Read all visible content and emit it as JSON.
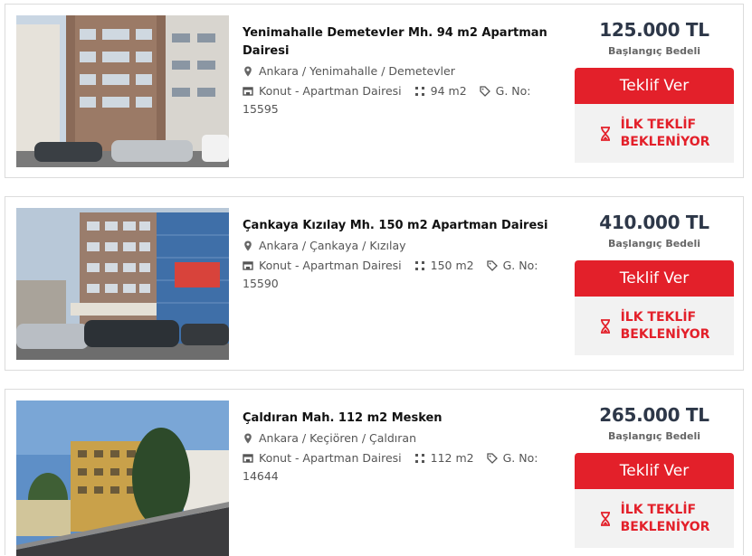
{
  "colors": {
    "accent_red": "#e3202a",
    "price_text": "#2d3748",
    "muted_text": "#555555",
    "panel_bg": "#f2f2f2"
  },
  "icons": {
    "location": "map-pin-icon",
    "type": "building-icon",
    "area": "area-icon",
    "id": "tag-icon",
    "waiting": "hourglass-icon"
  },
  "listings": [
    {
      "title": "Yenimahalle Demetevler Mh. 94 m2 Apartman Dairesi",
      "location": "Ankara / Yenimahalle / Demetevler",
      "type": "Konut - Apartman Dairesi",
      "area": "94 m2",
      "listing_no": "G. No: 15595",
      "price": "125.000 TL",
      "price_caption": "Başlangıç Bedeli",
      "offer_label": "Teklif Ver",
      "status_line1": "İLK TEKLİF",
      "status_line2": "BEKLENİYOR"
    },
    {
      "title": "Çankaya Kızılay Mh. 150 m2 Apartman Dairesi",
      "location": "Ankara / Çankaya / Kızılay",
      "type": "Konut - Apartman Dairesi",
      "area": "150 m2",
      "listing_no": "G. No: 15590",
      "price": "410.000 TL",
      "price_caption": "Başlangıç Bedeli",
      "offer_label": "Teklif Ver",
      "status_line1": "İLK TEKLİF",
      "status_line2": "BEKLENİYOR"
    },
    {
      "title": "Çaldıran Mah. 112 m2 Mesken",
      "location": "Ankara / Keçiören / Çaldıran",
      "type": "Konut - Apartman Dairesi",
      "area": "112 m2",
      "listing_no": "G. No: 14644",
      "price": "265.000 TL",
      "price_caption": "Başlangıç Bedeli",
      "offer_label": "Teklif Ver",
      "status_line1": "İLK TEKLİF",
      "status_line2": "BEKLENİYOR"
    }
  ]
}
